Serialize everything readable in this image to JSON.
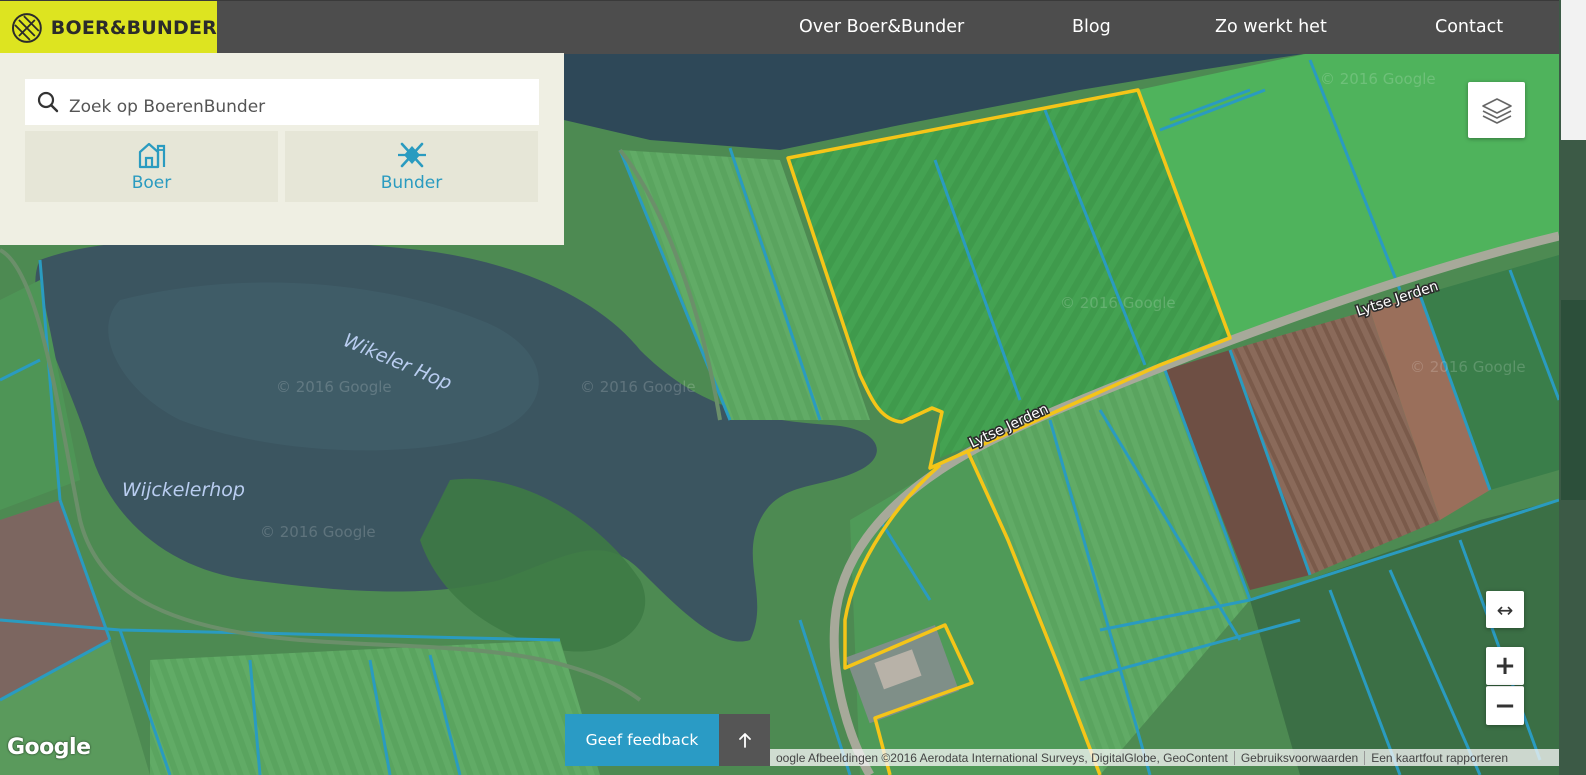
{
  "header": {
    "logo_text": "BOER&BUNDER",
    "nav": [
      {
        "label": "Over Boer&Bunder"
      },
      {
        "label": "Blog"
      },
      {
        "label": "Zo werkt het"
      },
      {
        "label": "Contact"
      }
    ]
  },
  "search": {
    "placeholder": "Zoek op BoerenBunder",
    "icon": "search-icon"
  },
  "modes": [
    {
      "label": "Boer",
      "icon": "farm-house-icon"
    },
    {
      "label": "Bunder",
      "icon": "field-marker-icon"
    }
  ],
  "map": {
    "labels": {
      "lake1": "Wikeler Hop",
      "lake2": "Wijckelerhop",
      "road1": "Lytse Jerden",
      "road2": "Lytse Jerden"
    },
    "watermark": "© 2016 Google",
    "parcel_outline_color": "#f5c518",
    "ditch_color": "#2a9bc0",
    "type": "satellite"
  },
  "controls": {
    "expand": "↔",
    "zoom_in": "+",
    "zoom_out": "−",
    "layers_icon": "layers-icon"
  },
  "footer": {
    "google_logo": "Google",
    "feedback_label": "Geef feedback",
    "to_top_icon": "arrow-up-icon",
    "attribution": "oogle Afbeeldingen ©2016 Aerodata International Surveys, DigitalGlobe, GeoContent",
    "terms": "Gebruiksvoorwaarden",
    "report": "Een kaartfout rapporteren"
  },
  "colors": {
    "header_bg": "#4d4d4d",
    "logo_bg": "#dde420",
    "accent": "#2a9bc5",
    "panel_bg": "#efefe3"
  }
}
